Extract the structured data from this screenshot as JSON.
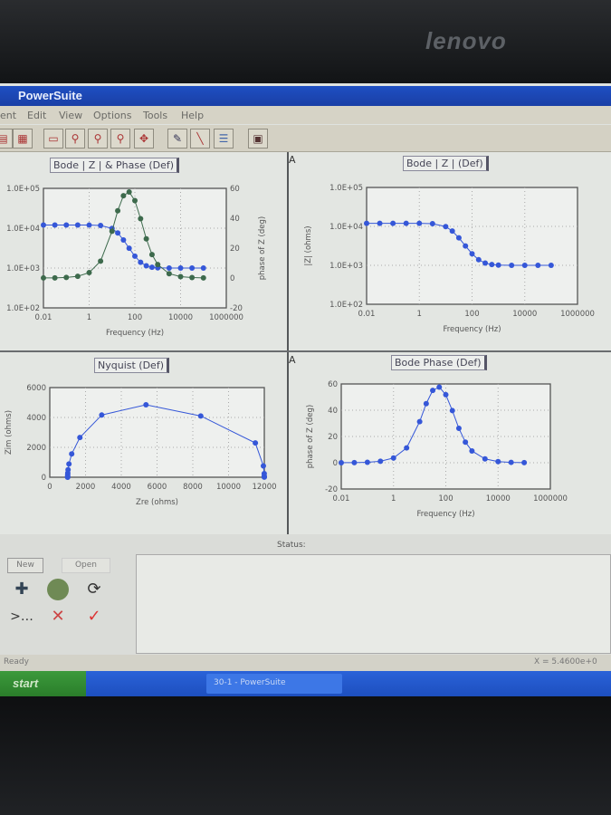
{
  "bezel": {
    "brand": "lenovo"
  },
  "window": {
    "title": "PowerSuite"
  },
  "menu": [
    "ent",
    "Edit",
    "View",
    "Options",
    "Tools",
    "Help"
  ],
  "toolbar": {
    "icons": [
      "print-icon",
      "grid-icon",
      "select-rect-icon",
      "zoom-icon",
      "zoom-in-icon",
      "zoom-out-icon",
      "zoom-fit-icon",
      "pen-icon",
      "line-icon",
      "layers-icon",
      "export-icon"
    ]
  },
  "panels": {
    "marker_a": "A"
  },
  "status": {
    "label": "Status:",
    "ready": "Ready",
    "coords": "X = 5.4600e+0",
    "new_button": "New",
    "open_button": "Open",
    "icons": [
      "add-experiment-icon",
      "run-icon",
      "refresh-icon",
      "prompt-icon",
      "cancel-icon",
      "accept-icon"
    ]
  },
  "taskbar": {
    "start": "start",
    "app": "30-1 - PowerSuite"
  },
  "colors": {
    "magnitude": "#3557d8",
    "phase": "#3d6a4c"
  },
  "chart_data": [
    {
      "type": "line",
      "title": "Bode | Z | & Phase (Def)",
      "xlabel": "Frequency (Hz)",
      "ylabel_right": "phase of Z (deg)",
      "x_scale": "log",
      "xlim": [
        0.01,
        1000000
      ],
      "y_scale": "log",
      "ylim": [
        100,
        100000
      ],
      "y2lim": [
        -20,
        60
      ],
      "x_ticks": [
        "0.01",
        "1",
        "100",
        "10000",
        "1000000"
      ],
      "y_ticks": [
        "1.0E+02",
        "1.0E+03",
        "1.0E+04",
        "1.0E+05"
      ],
      "y2_ticks": [
        "-20",
        "0",
        "20",
        "40",
        "60"
      ],
      "grid": true,
      "x": [
        0.01,
        0.0316,
        0.1,
        0.316,
        1,
        3.16,
        10,
        17.8,
        31.6,
        56.2,
        100,
        178,
        316,
        562,
        1000,
        3162,
        10000,
        31623,
        100000
      ],
      "series": [
        {
          "axis": "left",
          "values": [
            12000,
            12000,
            12000,
            11997,
            11972,
            11726,
            9888,
            7612,
            5076,
            3145,
            1983,
            1393,
            1140,
            1046,
            1015,
            1001,
            1000,
            1000,
            1000
          ]
        },
        {
          "axis": "right",
          "values": [
            0.04,
            0.11,
            0.36,
            1.15,
            3.6,
            11.3,
            31.3,
            45.0,
            55.1,
            57.6,
            51.8,
            39.7,
            26.2,
            15.7,
            9.0,
            2.9,
            0.9,
            0.3,
            0.1
          ]
        }
      ]
    },
    {
      "type": "line",
      "title": "Bode | Z | (Def)",
      "xlabel": "Frequency (Hz)",
      "ylabel": "|Z| (ohms)",
      "x_scale": "log",
      "xlim": [
        0.01,
        1000000
      ],
      "y_scale": "log",
      "ylim": [
        100,
        100000
      ],
      "x_ticks": [
        "0.01",
        "1",
        "100",
        "10000",
        "1000000"
      ],
      "y_ticks": [
        "1.0E+02",
        "1.0E+03",
        "1.0E+04",
        "1.0E+05"
      ],
      "grid": true,
      "x": [
        0.01,
        0.0316,
        0.1,
        0.316,
        1,
        3.16,
        10,
        17.8,
        31.6,
        56.2,
        100,
        178,
        316,
        562,
        1000,
        3162,
        10000,
        31623,
        100000
      ],
      "series": [
        {
          "values": [
            12000,
            12000,
            12000,
            11997,
            11972,
            11726,
            9888,
            7612,
            5076,
            3145,
            1983,
            1393,
            1140,
            1046,
            1015,
            1001,
            1000,
            1000,
            1000
          ]
        }
      ]
    },
    {
      "type": "scatter",
      "title": "Nyquist (Def)",
      "xlabel": "Zre (ohms)",
      "ylabel": "Zim (ohms)",
      "xlim": [
        0,
        12000
      ],
      "ylim": [
        0,
        6000
      ],
      "x_ticks": [
        "0",
        "2000",
        "4000",
        "6000",
        "8000",
        "10000",
        "12000"
      ],
      "y_ticks": [
        "0",
        "2000",
        "4000",
        "6000"
      ],
      "grid": true,
      "x": [
        12000,
        11999,
        11995,
        11995,
        11948,
        11499,
        8445,
        5381,
        2905,
        1684,
        1226,
        1072,
        1023,
        1007,
        1002,
        1000,
        1000,
        1000,
        1000
      ],
      "series": [
        {
          "values": [
            8,
            24,
            76,
            240,
            757,
            2294,
            4100,
            4850,
            4163,
            2656,
            1559,
            889,
            502,
            283,
            159,
            50,
            16,
            5,
            2
          ]
        }
      ]
    },
    {
      "type": "line",
      "title": "Bode Phase (Def)",
      "xlabel": "Frequency (Hz)",
      "ylabel": "phase of Z (deg)",
      "x_scale": "log",
      "xlim": [
        0.01,
        1000000
      ],
      "ylim": [
        -20,
        60
      ],
      "x_ticks": [
        "0.01",
        "1",
        "100",
        "10000",
        "1000000"
      ],
      "y_ticks": [
        "-20",
        "0",
        "20",
        "40",
        "60"
      ],
      "grid": true,
      "x": [
        0.01,
        0.0316,
        0.1,
        0.316,
        1,
        3.16,
        10,
        17.8,
        31.6,
        56.2,
        100,
        178,
        316,
        562,
        1000,
        3162,
        10000,
        31623,
        100000
      ],
      "series": [
        {
          "values": [
            0.04,
            0.11,
            0.36,
            1.15,
            3.6,
            11.3,
            31.3,
            45.0,
            55.1,
            57.6,
            51.8,
            39.7,
            26.2,
            15.7,
            9.0,
            2.9,
            0.9,
            0.3,
            0.1
          ]
        }
      ]
    }
  ]
}
